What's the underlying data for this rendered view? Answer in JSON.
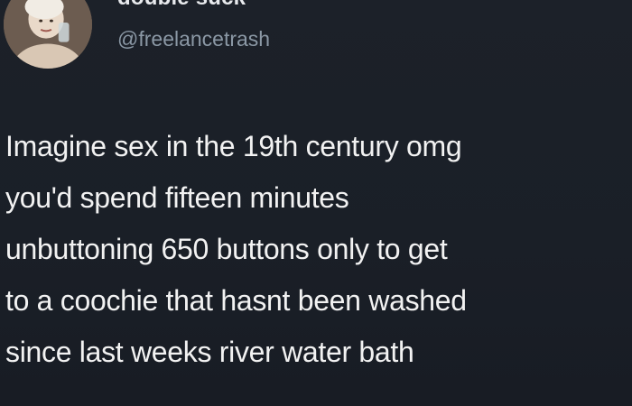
{
  "tweet": {
    "display_name": "double suck",
    "handle": "@freelancetrash",
    "avatar_icon": "profile-photo-avatar",
    "text_lines": [
      "Imagine sex in the 19th century omg",
      "you'd spend fifteen minutes",
      "unbuttoning 650 buttons only to get",
      "to a coochie that hasnt been washed",
      "since last weeks river water bath"
    ]
  },
  "colors": {
    "background": "#1b2028",
    "text": "#f2f2f2",
    "handle": "#8b98a5"
  }
}
